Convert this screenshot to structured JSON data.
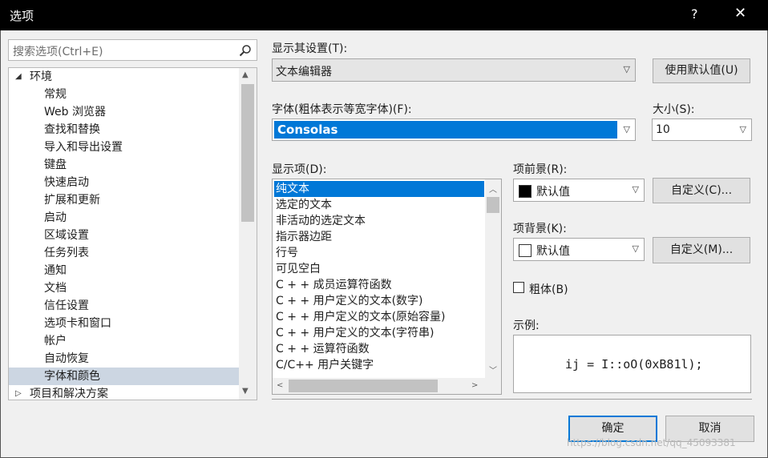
{
  "window": {
    "title": "选项",
    "help": "?",
    "close": "✕"
  },
  "search": {
    "placeholder": "搜索选项(Ctrl+E)"
  },
  "tree": {
    "root": "环境",
    "items": [
      "常规",
      "Web 浏览器",
      "查找和替换",
      "导入和导出设置",
      "键盘",
      "快速启动",
      "扩展和更新",
      "启动",
      "区域设置",
      "任务列表",
      "通知",
      "文档",
      "信任设置",
      "选项卡和窗口",
      "帐户",
      "自动恢复",
      "字体和颜色"
    ],
    "selected": "字体和颜色",
    "next_root": "项目和解决方案"
  },
  "settings_for": {
    "label": "显示其设置(T):",
    "value": "文本编辑器"
  },
  "use_defaults_button": "使用默认值(U)",
  "font": {
    "label": "字体(粗体表示等宽字体)(F):",
    "value": "Consolas"
  },
  "size": {
    "label": "大小(S):",
    "value": "10"
  },
  "display_items": {
    "label": "显示项(D):",
    "items": [
      "纯文本",
      "选定的文本",
      "非活动的选定文本",
      "指示器边距",
      "行号",
      "可见空白",
      "C + + 成员运算符函数",
      "C + + 用户定义的文本(数字)",
      "C + + 用户定义的文本(原始容量)",
      "C + + 用户定义的文本(字符串)",
      "C + + 运算符函数",
      "C/C++ 用户关键字"
    ],
    "selected": "纯文本"
  },
  "foreground": {
    "label": "项前景(R):",
    "value": "默认值",
    "swatch_color": "#000000",
    "custom_button": "自定义(C)..."
  },
  "background": {
    "label": "项背景(K):",
    "value": "默认值",
    "swatch_color": "#ffffff",
    "custom_button": "自定义(M)..."
  },
  "bold": {
    "label": "粗体(B)"
  },
  "sample": {
    "label": "示例:",
    "text": "ij = I::oO(0xB81l);"
  },
  "ok_button": "确定",
  "cancel_button": "取消",
  "watermark": "https://blog.csdn.net/qq_45093381"
}
